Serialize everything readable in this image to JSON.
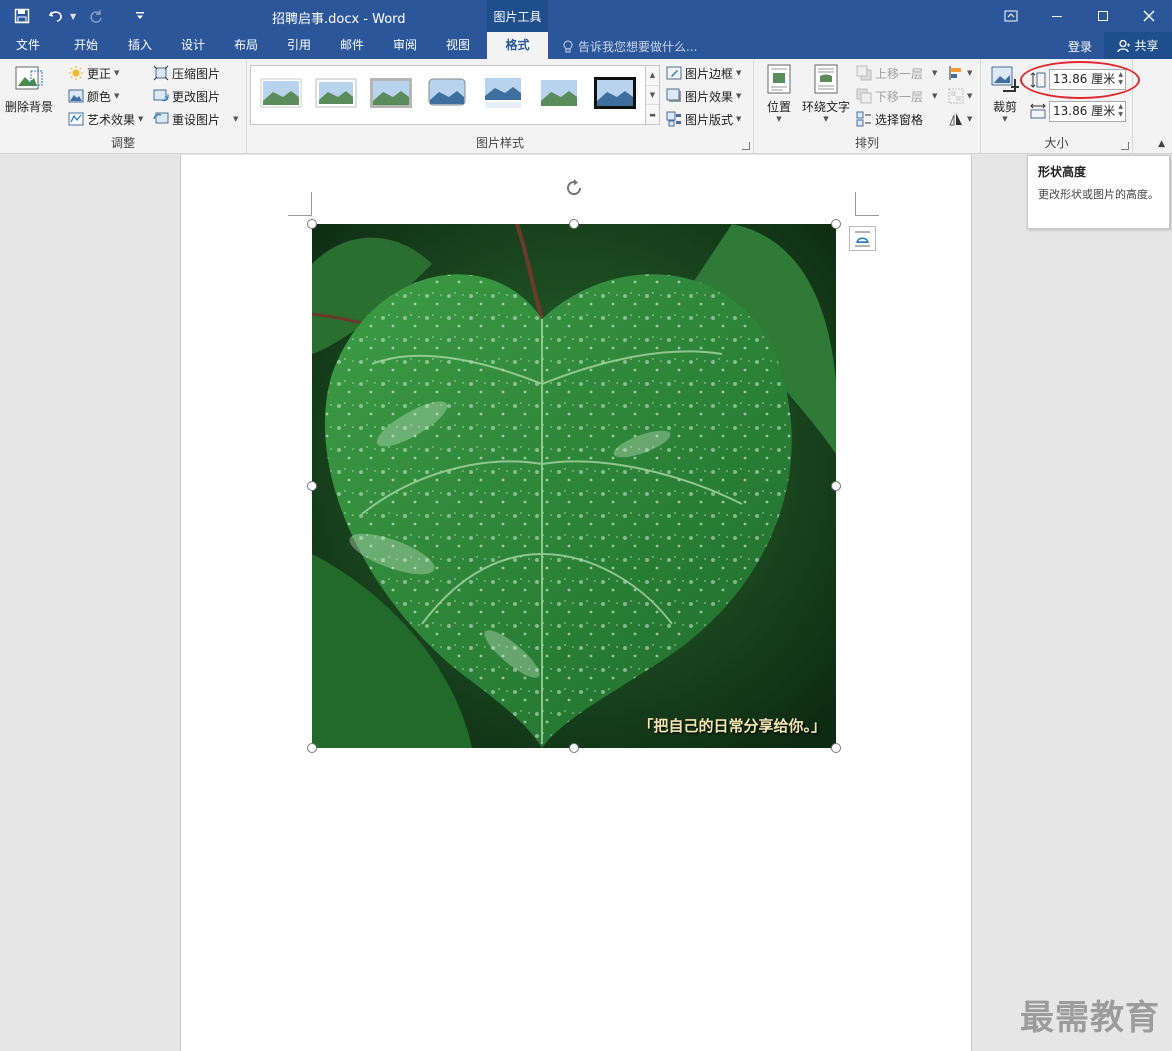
{
  "titlebar": {
    "doc_title": "招聘启事.docx - Word",
    "context_tab": "图片工具"
  },
  "tabs": [
    {
      "label": "文件"
    },
    {
      "label": "开始"
    },
    {
      "label": "插入"
    },
    {
      "label": "设计"
    },
    {
      "label": "布局"
    },
    {
      "label": "引用"
    },
    {
      "label": "邮件"
    },
    {
      "label": "审阅"
    },
    {
      "label": "视图"
    },
    {
      "label": "格式"
    }
  ],
  "tell_me_placeholder": "告诉我您想要做什么...",
  "account": {
    "login": "登录",
    "share": "共享"
  },
  "ribbon": {
    "adjust": {
      "remove_bg": "删除背景",
      "corrections": "更正",
      "color": "颜色",
      "artistic": "艺术效果",
      "compress": "压缩图片",
      "change": "更改图片",
      "reset": "重设图片",
      "label": "调整"
    },
    "styles": {
      "border": "图片边框",
      "effects": "图片效果",
      "layout": "图片版式",
      "label": "图片样式"
    },
    "arrange": {
      "position": "位置",
      "wrap": "环绕文字",
      "forward": "上移一层",
      "backward": "下移一层",
      "pane": "选择窗格",
      "label": "排列"
    },
    "size": {
      "crop": "裁剪",
      "height": "13.86 厘米",
      "width": "13.86 厘米",
      "label": "大小"
    }
  },
  "tooltip": {
    "title": "形状高度",
    "body": "更改形状或图片的高度。"
  },
  "image_caption": "「把自己的日常分享给你。」",
  "watermark": "最需教育",
  "colors": {
    "brand_blue": "#2b579a",
    "highlight_red": "#e0282e",
    "leaf_green": "#2e8a3e"
  }
}
